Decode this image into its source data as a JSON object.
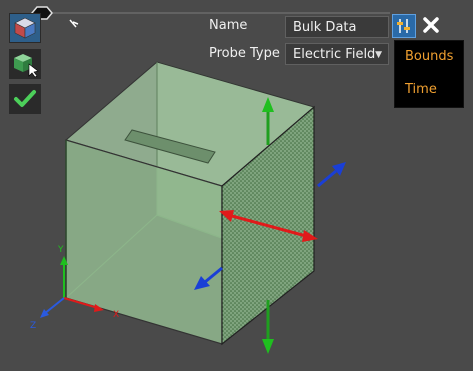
{
  "toolbar": {
    "view_cube_icon": "view-cube-icon",
    "select_icon": "select-cube-icon",
    "accept_icon": "checkmark-icon"
  },
  "probe_panel": {
    "name_label": "Name",
    "name_value": "Bulk Data",
    "probe_type_label": "Probe Type",
    "probe_type_value": "Electric Field"
  },
  "menu": {
    "items": [
      "Bounds",
      "Time"
    ]
  },
  "axes": {
    "y": "Y",
    "x": "X",
    "z": "Z"
  },
  "colors": {
    "accent": "#2a6aa8",
    "menu_text": "#f0a030",
    "cube_fill": "#9cc89a"
  }
}
